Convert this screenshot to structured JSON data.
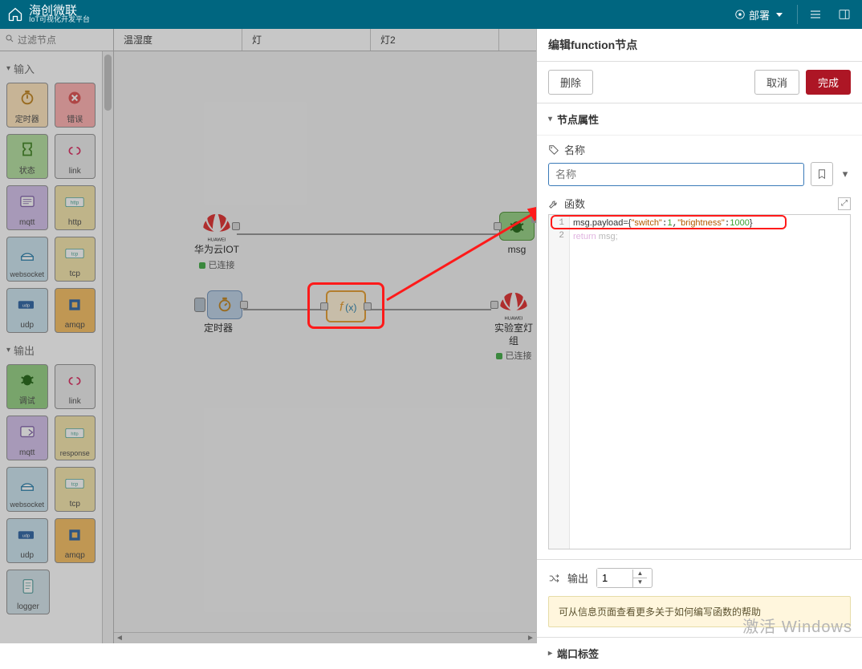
{
  "brand": {
    "name": "海创微联",
    "subtitle": "IoT可视化开发平台"
  },
  "topbar": {
    "deploy": "部署"
  },
  "palette": {
    "filter_placeholder": "过滤节点",
    "cat_input": "输入",
    "cat_output": "输出",
    "input_nodes": [
      "定时器",
      "错误",
      "状态",
      "link",
      "mqtt",
      "http",
      "websocket",
      "tcp",
      "udp",
      "amqp"
    ],
    "output_nodes": [
      "调试",
      "link",
      "mqtt",
      "response",
      "websocket",
      "tcp",
      "udp",
      "amqp",
      "logger"
    ]
  },
  "tabs": [
    "温湿度",
    "灯",
    "灯2"
  ],
  "canvas": {
    "huawei": {
      "label": "华为云IOT",
      "status": "已连接"
    },
    "msg": {
      "label": "msg"
    },
    "timer": {
      "label": "定时器"
    },
    "lightgroup": {
      "label": "实验室灯组",
      "status": "已连接"
    }
  },
  "editpanel": {
    "title": "编辑function节点",
    "btn_delete": "删除",
    "btn_cancel": "取消",
    "btn_done": "完成",
    "section_props": "节点属性",
    "label_name": "名称",
    "name_placeholder": "名称",
    "label_function": "函数",
    "code_line1_prefix": "msg.payload={",
    "code_line1_k1": "\"switch\"",
    "code_line1_v1": "1",
    "code_line1_k2": "\"brightness\"",
    "code_line1_v2": "1000",
    "code_line1_suffix": "}",
    "code_line2_ret": "return",
    "code_line2_rest": " msg;",
    "label_output": "输出",
    "output_count": "1",
    "hint": "可从信息页面查看更多关于如何编写函数的帮助",
    "section_ports": "端口标签"
  },
  "watermark": "激活 Windows"
}
